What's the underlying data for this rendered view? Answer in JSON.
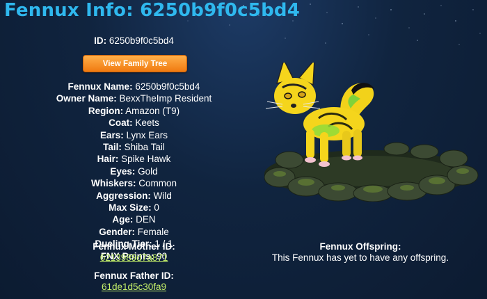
{
  "page": {
    "title": "Fennux Info: 6250b9f0c5bd4"
  },
  "id_line": {
    "label": "ID:",
    "value": "6250b9f0c5bd4"
  },
  "family_tree_button": "View Family Tree",
  "fields": [
    {
      "label": "Fennux Name:",
      "value": "6250b9f0c5bd4"
    },
    {
      "label": "Owner Name:",
      "value": "BexxTheImp Resident"
    },
    {
      "label": "Region:",
      "value": "Amazon (T9)"
    },
    {
      "label": "Coat:",
      "value": "Keets"
    },
    {
      "label": "Ears:",
      "value": "Lynx Ears"
    },
    {
      "label": "Tail:",
      "value": "Shiba Tail"
    },
    {
      "label": "Hair:",
      "value": "Spike Hawk"
    },
    {
      "label": "Eyes:",
      "value": "Gold"
    },
    {
      "label": "Whiskers:",
      "value": "Common"
    },
    {
      "label": "Aggression:",
      "value": "Wild"
    },
    {
      "label": "Max Size:",
      "value": "0"
    },
    {
      "label": "Age:",
      "value": "DEN"
    },
    {
      "label": "Gender:",
      "value": "Female"
    },
    {
      "label": "Dueling Tier:",
      "value": "1 / 1"
    },
    {
      "label": "FNX Points:",
      "value": "90"
    }
  ],
  "parents": {
    "mother_label": "Fennux Mother ID:",
    "mother_id": "6213989d7a871",
    "father_label": "Fennux Father ID:",
    "father_id": "61de1d5c30fa9"
  },
  "offspring": {
    "label": "Fennux Offspring:",
    "text": "This Fennux has yet to have any offspring."
  },
  "colors": {
    "title": "#2fb8ee",
    "button": "#f5901e",
    "link": "#c6f26a",
    "background": "#10243f"
  },
  "image": {
    "subject": "fennux-creature-portrait"
  }
}
